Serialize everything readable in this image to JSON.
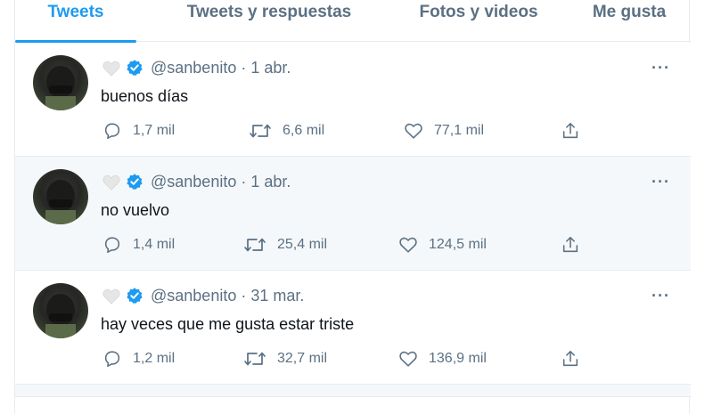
{
  "tabs": [
    {
      "label": "Tweets",
      "active": true
    },
    {
      "label": "Tweets y respuestas",
      "active": false
    },
    {
      "label": "Fotos y videos",
      "active": false
    },
    {
      "label": "Me gusta",
      "active": false
    }
  ],
  "tweets": [
    {
      "handle": "@sanbenito",
      "date": "· 1 abr.",
      "text": "buenos días",
      "replies": "1,7 mil",
      "retweets": "6,6 mil",
      "likes": "77,1 mil"
    },
    {
      "handle": "@sanbenito",
      "date": "· 1 abr.",
      "text": "no vuelvo",
      "replies": "1,4 mil",
      "retweets": "25,4 mil",
      "likes": "124,5 mil"
    },
    {
      "handle": "@sanbenito",
      "date": "· 31 mar.",
      "text": "hay veces que me gusta estar triste",
      "replies": "1,2 mil",
      "retweets": "32,7 mil",
      "likes": "136,9 mil"
    }
  ],
  "more_label": "···",
  "colors": {
    "accent": "#1d9bf0",
    "muted": "#5b7083",
    "border": "#e6ecf0",
    "row_highlight": "#f5f8fa"
  },
  "icons": [
    "white-heart-icon",
    "verified-icon",
    "reply-icon",
    "retweet-icon",
    "like-icon",
    "share-icon",
    "more-icon"
  ]
}
